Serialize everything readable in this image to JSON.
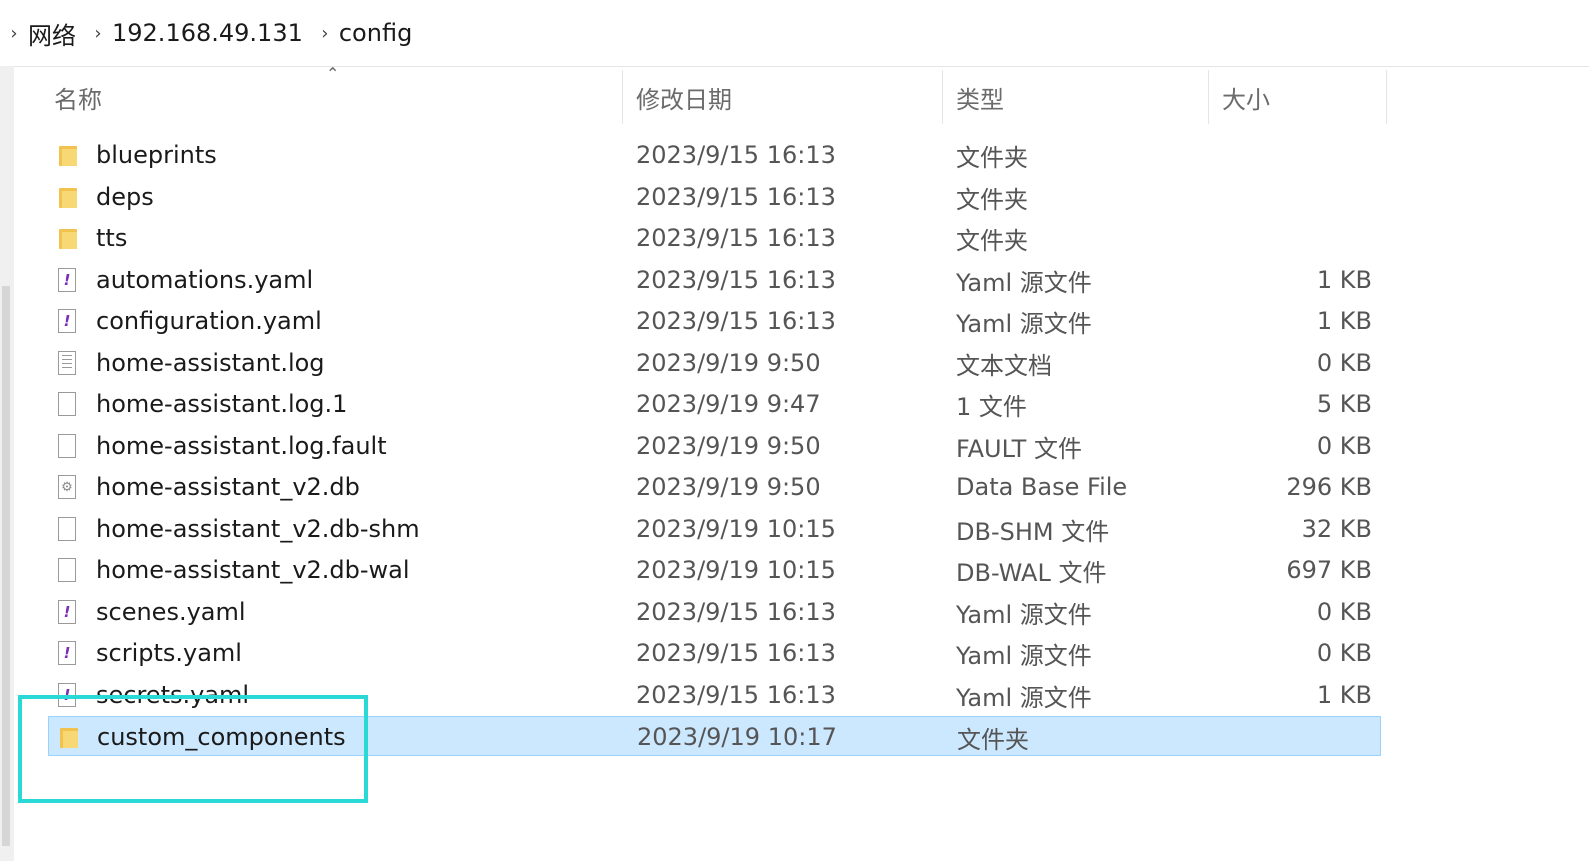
{
  "breadcrumb": {
    "items": [
      "网络",
      "192.168.49.131",
      "config"
    ]
  },
  "columns": {
    "name": "名称",
    "date": "修改日期",
    "type": "类型",
    "size": "大小"
  },
  "files": [
    {
      "name": "blueprints",
      "date": "2023/9/15 16:13",
      "type": "文件夹",
      "size": "",
      "icon": "folder-icon"
    },
    {
      "name": "deps",
      "date": "2023/9/15 16:13",
      "type": "文件夹",
      "size": "",
      "icon": "folder-icon"
    },
    {
      "name": "tts",
      "date": "2023/9/15 16:13",
      "type": "文件夹",
      "size": "",
      "icon": "folder-icon"
    },
    {
      "name": "automations.yaml",
      "date": "2023/9/15 16:13",
      "type": "Yaml 源文件",
      "size": "1 KB",
      "icon": "yaml-file-icon"
    },
    {
      "name": "configuration.yaml",
      "date": "2023/9/15 16:13",
      "type": "Yaml 源文件",
      "size": "1 KB",
      "icon": "yaml-file-icon"
    },
    {
      "name": "home-assistant.log",
      "date": "2023/9/19 9:50",
      "type": "文本文档",
      "size": "0 KB",
      "icon": "text-file-icon"
    },
    {
      "name": "home-assistant.log.1",
      "date": "2023/9/19 9:47",
      "type": "1 文件",
      "size": "5 KB",
      "icon": "file-icon"
    },
    {
      "name": "home-assistant.log.fault",
      "date": "2023/9/19 9:50",
      "type": "FAULT 文件",
      "size": "0 KB",
      "icon": "file-icon"
    },
    {
      "name": "home-assistant_v2.db",
      "date": "2023/9/19 9:50",
      "type": "Data Base File",
      "size": "296 KB",
      "icon": "database-file-icon"
    },
    {
      "name": "home-assistant_v2.db-shm",
      "date": "2023/9/19 10:15",
      "type": "DB-SHM 文件",
      "size": "32 KB",
      "icon": "file-icon"
    },
    {
      "name": "home-assistant_v2.db-wal",
      "date": "2023/9/19 10:15",
      "type": "DB-WAL 文件",
      "size": "697 KB",
      "icon": "file-icon"
    },
    {
      "name": "scenes.yaml",
      "date": "2023/9/15 16:13",
      "type": "Yaml 源文件",
      "size": "0 KB",
      "icon": "yaml-file-icon"
    },
    {
      "name": "scripts.yaml",
      "date": "2023/9/15 16:13",
      "type": "Yaml 源文件",
      "size": "0 KB",
      "icon": "yaml-file-icon"
    },
    {
      "name": "secrets.yaml",
      "date": "2023/9/15 16:13",
      "type": "Yaml 源文件",
      "size": "1 KB",
      "icon": "yaml-file-icon"
    },
    {
      "name": "custom_components",
      "date": "2023/9/19 10:17",
      "type": "文件夹",
      "size": "",
      "icon": "folder-icon",
      "selected": true
    }
  ],
  "colors": {
    "selection_bg": "#cce8ff",
    "selection_border": "#99d1ff",
    "annotation_box": "#2ad9d5",
    "yaml_icon": "#7a2fb5",
    "folder": "#f2c24f"
  }
}
